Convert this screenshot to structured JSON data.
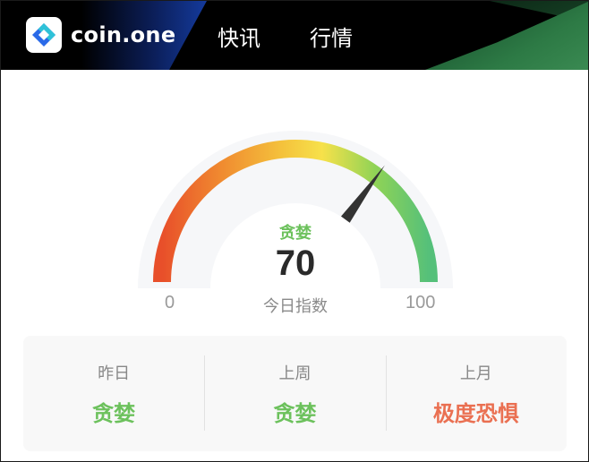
{
  "header": {
    "logo_text": "coin.one",
    "logo_icon": "diamond-logo-icon",
    "tabs": [
      {
        "label": "快讯"
      },
      {
        "label": "行情"
      }
    ]
  },
  "gauge": {
    "value": 70,
    "min_label": "0",
    "max_label": "100",
    "min": 0,
    "max": 100,
    "sentiment": "贪婪",
    "value_text": "70",
    "caption": "今日指数",
    "sentiment_color": "#6cc15c",
    "gradient_colors": [
      "#e84f2a",
      "#f08a30",
      "#f4c23c",
      "#f7e14a",
      "#8fd356",
      "#55c07a"
    ]
  },
  "history": [
    {
      "period": "昨日",
      "sentiment": "贪婪",
      "color": "#6cc15c"
    },
    {
      "period": "上周",
      "sentiment": "贪婪",
      "color": "#6cc15c"
    },
    {
      "period": "上月",
      "sentiment": "极度恐惧",
      "color": "#ea7052"
    }
  ]
}
